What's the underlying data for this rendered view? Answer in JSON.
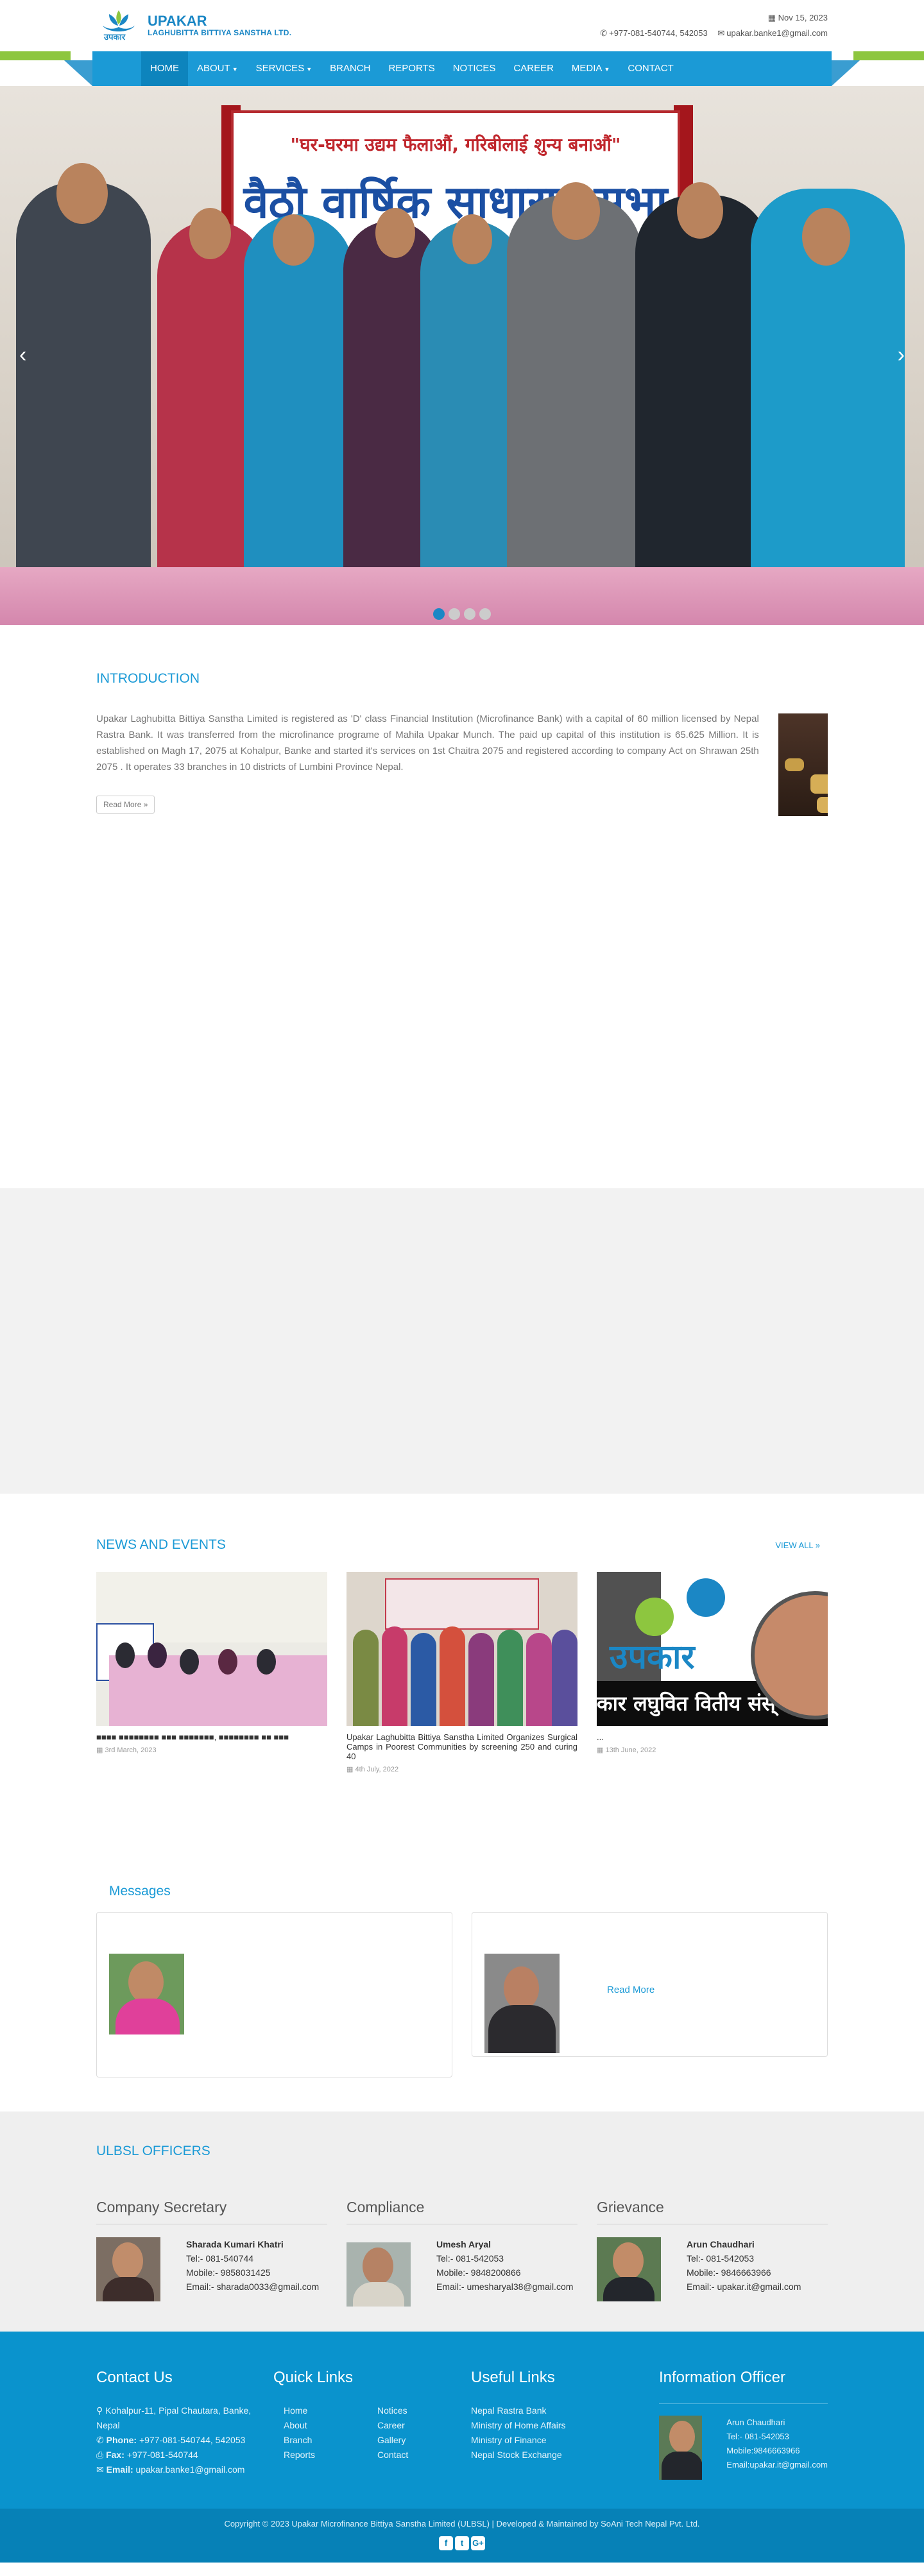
{
  "header": {
    "brand": "UPAKAR",
    "brand_sub": "LAGHUBITTA BITTIYA SANSTHA LTD.",
    "logo_text": "उपकार",
    "date": "Nov 15, 2023",
    "phone": "+977-081-540744, 542053",
    "email": "upakar.banke1@gmail.com"
  },
  "nav": {
    "items": [
      "HOME",
      "ABOUT",
      "SERVICES",
      "BRANCH",
      "REPORTS",
      "NOTICES",
      "CAREER",
      "MEDIA",
      "CONTACT"
    ]
  },
  "hero": {
    "banner_line1": "\"घर-घरमा उद्यम फैलाऔं, गरिबीलाई शुन्य बनाऔं\"",
    "banner_line2": "वैठौ वार्षिक साधारण सभा",
    "slides": 4,
    "active_slide": 1
  },
  "intro": {
    "title": "INTRODUCTION",
    "text": "Upakar Laghubitta  Bittiya Sanstha Limited is registered as 'D' class Financial Institution (Microfinance Bank) with a capital of 60 million licensed by Nepal Rastra Bank. It was transferred from the microfinance programe of Mahila Upakar Munch. The paid up capital of this institution is 65.625 Million. It is established on Magh 17, 2075 at Kohalpur, Banke and started it's services on 1st Chaitra 2075 and registered according to company Act on Shrawan  25th 2075 . It operates 33 branches in 10 districts of  Lumbini Province Nepal.",
    "read_more": "Read More »"
  },
  "news": {
    "title": "NEWS AND EVENTS",
    "view_all": "VIEW ALL »",
    "items": [
      {
        "title": "■■■■ ■■■■■■■■ ■■■ ■■■■■■■, ■■■■■■■■ ■■ ■■■",
        "date": "3rd March, 2023"
      },
      {
        "title": "Upakar Laghubitta Bittiya Sanstha Limited Organizes Surgical Camps in Poorest Communities by screening 250 and curing 40",
        "date": "4th July, 2022"
      },
      {
        "title": "...",
        "date": "13th June, 2022"
      }
    ],
    "banner_text": "उपकार",
    "banner_text2": "कार लघुवित वितीय संस्"
  },
  "messages": {
    "title": "Messages",
    "read_more": "Read More"
  },
  "officers": {
    "title": "ULBSL OFFICERS",
    "cols": [
      {
        "role": "Company Secretary",
        "name": "Sharada Kumari Khatri",
        "tel": "Tel:- 081-540744",
        "mobile": "Mobile:- 9858031425",
        "email": "Email:- sharada0033@gmail.com"
      },
      {
        "role": "Compliance",
        "name": "Umesh Aryal",
        "tel": "Tel:- 081-542053",
        "mobile": "Mobile:- 9848200866",
        "email": "Email:- umesharyal38@gmail.com"
      },
      {
        "role": "Grievance",
        "name": "Arun Chaudhari",
        "tel": "Tel:- 081-542053",
        "mobile": "Mobile:- 9846663966",
        "email": "Email:- upakar.it@gmail.com"
      }
    ]
  },
  "footer": {
    "contact_title": "Contact Us",
    "address": "Kohalpur-11, Pipal Chautara, Banke, Nepal",
    "phone_label": "Phone:",
    "phone": "+977-081-540744, 542053",
    "fax_label": "Fax:",
    "fax": "+977-081-540744",
    "email_label": "Email:",
    "email": "upakar.banke1@gmail.com",
    "quick_title": "Quick Links",
    "quick_a": [
      "Home",
      "About",
      "Branch",
      "Reports"
    ],
    "quick_b": [
      "Notices",
      "Career",
      "Gallery",
      "Contact"
    ],
    "useful_title": "Useful Links",
    "useful": [
      "Nepal Rastra Bank",
      "Ministry of Home Affairs",
      "Ministry of Finance",
      "Nepal Stock Exchange"
    ],
    "info_title": "Information Officer",
    "info_name": "Arun Chaudhari",
    "info_tel": "Tel:- 081-542053",
    "info_mobile": "Mobile:9846663966",
    "info_email": "Email:upakar.it@gmail.com",
    "copyright": "Copyright © 2023 Upakar Microfinance Bittiya Sanstha Limited (ULBSL) | Developed & Maintained by SoAni Tech Nepal Pvt. Ltd.",
    "social": [
      "f",
      "t",
      "G+"
    ]
  },
  "colors": {
    "primary": "#1b9ad6",
    "green": "#8dc63f",
    "footer": "#0a93cd"
  }
}
